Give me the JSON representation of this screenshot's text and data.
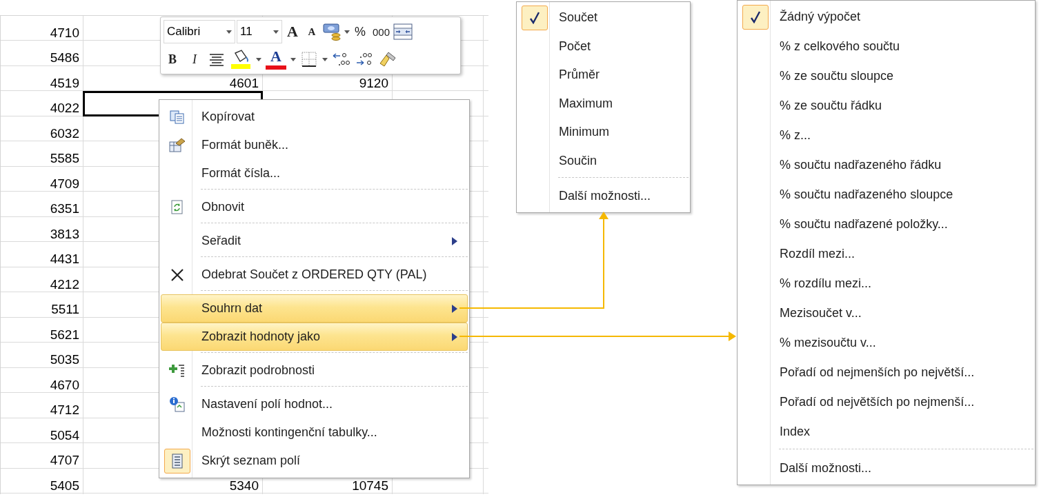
{
  "sheet": {
    "rows": [
      {
        "a": "4710",
        "selected": false
      },
      {
        "a": "5486",
        "selected": false
      },
      {
        "a": "4519",
        "b": "4601",
        "c": "9120",
        "selected": false
      },
      {
        "a": "4022",
        "selected": true
      },
      {
        "a": "6032",
        "selected": false
      },
      {
        "a": "5585",
        "selected": false
      },
      {
        "a": "4709",
        "selected": false
      },
      {
        "a": "6351",
        "selected": false
      },
      {
        "a": "3813",
        "selected": false
      },
      {
        "a": "4431",
        "selected": false
      },
      {
        "a": "4212",
        "selected": false
      },
      {
        "a": "5511",
        "selected": false
      },
      {
        "a": "5621",
        "selected": false
      },
      {
        "a": "5035",
        "selected": false
      },
      {
        "a": "4670",
        "selected": false
      },
      {
        "a": "4712",
        "selected": false
      },
      {
        "a": "5054",
        "selected": false
      },
      {
        "a": "4707",
        "selected": false
      },
      {
        "a": "5405",
        "b": "5340",
        "c": "10745",
        "selected": false
      }
    ]
  },
  "mini_toolbar": {
    "font": "Calibri",
    "size": "11",
    "grow_font": "A",
    "shrink_font": "A",
    "percent": "%",
    "thousands": "000",
    "bold": "B",
    "italic": "I",
    "font_color": "A"
  },
  "context_menu": {
    "items": [
      {
        "label": "Kopírovat",
        "kind": "command",
        "highlighted": false,
        "checked": false,
        "divider_before": false
      },
      {
        "label": "Formát buněk...",
        "kind": "command",
        "highlighted": false,
        "checked": false,
        "divider_before": false
      },
      {
        "label": "Formát čísla...",
        "kind": "command",
        "highlighted": false,
        "checked": false,
        "divider_before": false
      },
      {
        "label": "Obnovit",
        "kind": "command",
        "highlighted": false,
        "checked": false,
        "divider_before": true
      },
      {
        "label": "Seřadit",
        "kind": "submenu",
        "highlighted": false,
        "checked": false,
        "divider_before": true
      },
      {
        "label": "Odebrat Součet z ORDERED QTY (PAL)",
        "kind": "command",
        "highlighted": false,
        "checked": false,
        "divider_before": true
      },
      {
        "label": "Souhrn dat",
        "kind": "submenu",
        "highlighted": true,
        "checked": false,
        "divider_before": true
      },
      {
        "label": "Zobrazit hodnoty jako",
        "kind": "submenu",
        "highlighted": true,
        "checked": false,
        "divider_before": false
      },
      {
        "label": "Zobrazit podrobnosti",
        "kind": "command",
        "highlighted": false,
        "checked": false,
        "divider_before": true
      },
      {
        "label": "Nastavení polí hodnot...",
        "kind": "command",
        "highlighted": false,
        "checked": false,
        "divider_before": true
      },
      {
        "label": "Možnosti kontingenční tabulky...",
        "kind": "command",
        "highlighted": false,
        "checked": false,
        "divider_before": false
      },
      {
        "label": "Skrýt seznam polí",
        "kind": "command",
        "highlighted": false,
        "checked": true,
        "divider_before": false
      }
    ]
  },
  "summarize_menu": {
    "items": [
      {
        "label": "Součet",
        "checked": true,
        "divider_before": false
      },
      {
        "label": "Počet",
        "checked": false,
        "divider_before": false
      },
      {
        "label": "Průměr",
        "checked": false,
        "divider_before": false
      },
      {
        "label": "Maximum",
        "checked": false,
        "divider_before": false
      },
      {
        "label": "Minimum",
        "checked": false,
        "divider_before": false
      },
      {
        "label": "Součin",
        "checked": false,
        "divider_before": false
      },
      {
        "label": "Další možnosti...",
        "checked": false,
        "divider_before": true
      }
    ]
  },
  "show_values_menu": {
    "items": [
      {
        "label": "Žádný výpočet",
        "checked": true,
        "divider_before": false
      },
      {
        "label": "% z celkového součtu",
        "checked": false,
        "divider_before": false
      },
      {
        "label": "% ze součtu sloupce",
        "checked": false,
        "divider_before": false
      },
      {
        "label": "% ze součtu řádku",
        "checked": false,
        "divider_before": false
      },
      {
        "label": "% z...",
        "checked": false,
        "divider_before": false
      },
      {
        "label": "% součtu nadřazeného řádku",
        "checked": false,
        "divider_before": false
      },
      {
        "label": "% součtu nadřazeného sloupce",
        "checked": false,
        "divider_before": false
      },
      {
        "label": "% součtu nadřazené položky...",
        "checked": false,
        "divider_before": false
      },
      {
        "label": "Rozdíl mezi...",
        "checked": false,
        "divider_before": false
      },
      {
        "label": "% rozdílu mezi...",
        "checked": false,
        "divider_before": false
      },
      {
        "label": "Mezisoučet v...",
        "checked": false,
        "divider_before": false
      },
      {
        "label": "% mezisoučtu v...",
        "checked": false,
        "divider_before": false
      },
      {
        "label": "Pořadí od nejmenších po největší...",
        "checked": false,
        "divider_before": false
      },
      {
        "label": "Pořadí od největších po nejmenší...",
        "checked": false,
        "divider_before": false
      },
      {
        "label": "Index",
        "checked": false,
        "divider_before": false
      },
      {
        "label": "Další možnosti...",
        "checked": false,
        "divider_before": true
      }
    ]
  }
}
